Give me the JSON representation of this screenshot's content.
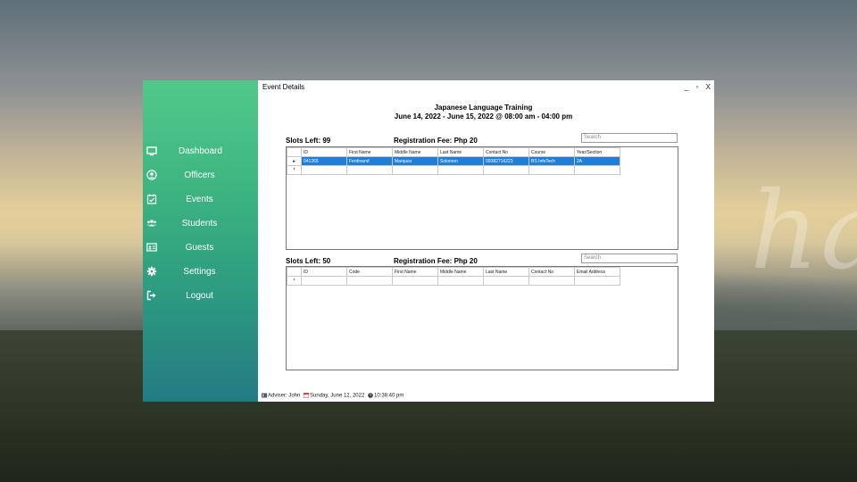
{
  "watermark": "helping hand",
  "sidebar": {
    "items": [
      {
        "label": "Dashboard",
        "icon": "monitor-icon"
      },
      {
        "label": "Officers",
        "icon": "user-circle-icon"
      },
      {
        "label": "Events",
        "icon": "calendar-check-icon"
      },
      {
        "label": "Students",
        "icon": "users-icon"
      },
      {
        "label": "Guests",
        "icon": "id-card-icon"
      },
      {
        "label": "Settings",
        "icon": "gear-icon"
      },
      {
        "label": "Logout",
        "icon": "logout-icon"
      }
    ]
  },
  "window": {
    "title": "Event Details",
    "minimize": "_",
    "maximize": "▫",
    "close": "X"
  },
  "event": {
    "name": "Japanese Language Training",
    "schedule": "June 14, 2022 - June 15, 2022 @ 08:00 am - 04:00 pm"
  },
  "students_section": {
    "slots": "Slots Left: 99",
    "fee": "Registration Fee: Php 20",
    "search_placeholder": "Search",
    "columns": [
      "ID",
      "First Name",
      "Middle Name",
      "Last Name",
      "Contact No",
      "Course",
      "Year/Section"
    ],
    "rows": [
      {
        "marker": "▸",
        "cells": [
          "041265",
          "Ferdinand",
          "Marquez",
          "Solomon",
          "09382716223",
          "BS InfoTech",
          "2A"
        ]
      }
    ],
    "new_row_marker": "*"
  },
  "guests_section": {
    "slots": "Slots Left: 50",
    "fee": "Registration Fee: Php 20",
    "search_placeholder": "Search",
    "columns": [
      "ID",
      "Code",
      "First Name",
      "Middle Name",
      "Last Name",
      "Contact No",
      "Email Address"
    ],
    "new_row_marker": "*"
  },
  "status_bar": {
    "adviser": "Adviser: John",
    "date": "Sunday, June 12, 2022",
    "time": "10:38:40 pm"
  }
}
